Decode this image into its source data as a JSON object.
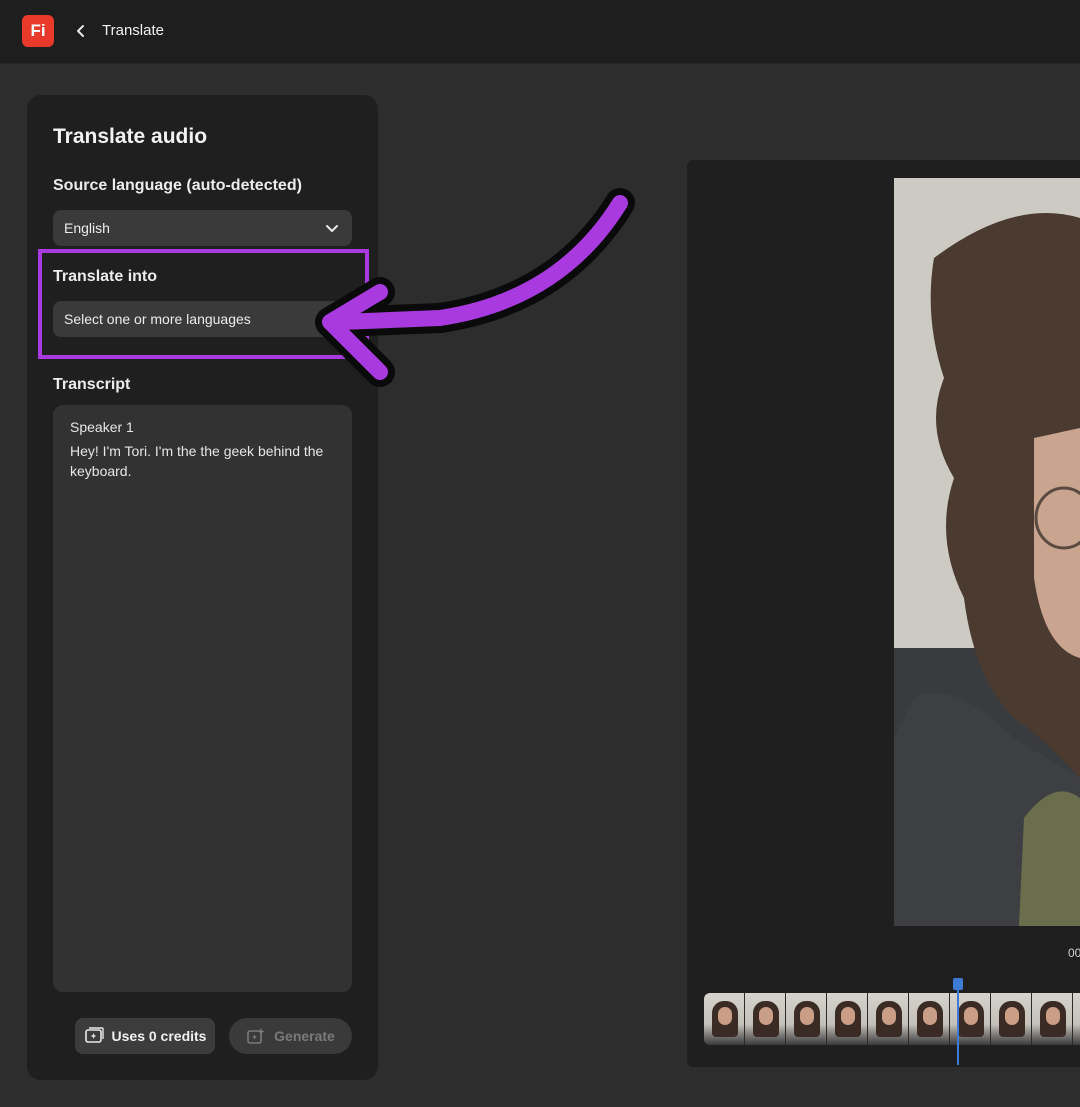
{
  "header": {
    "app_logo": "Fi",
    "back_icon": "chevron-left-icon",
    "title": "Translate"
  },
  "panel": {
    "title": "Translate audio",
    "source_language": {
      "label": "Source language (auto-detected)",
      "value": "English"
    },
    "translate_into": {
      "label": "Translate into",
      "placeholder": "Select one or more languages"
    },
    "transcript": {
      "label": "Transcript",
      "speaker": "Speaker 1",
      "text": "Hey! I'm Tori. I'm the the geek behind the keyboard."
    },
    "credits_button": "Uses 0 credits",
    "generate_button": "Generate"
  },
  "preview": {
    "timecode": "00"
  },
  "colors": {
    "annotation": "#a93ae0",
    "logo_bg": "#e8392a",
    "playhead": "#3d7bd6"
  }
}
